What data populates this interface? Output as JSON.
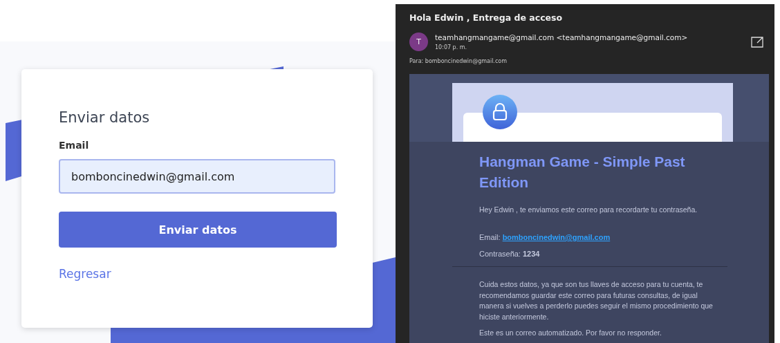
{
  "login": {
    "title": "Enviar datos",
    "email_label": "Email",
    "email_value": "bomboncinedwin@gmail.com",
    "submit_label": "Enviar datos",
    "back_link": "Regresar"
  },
  "email": {
    "subject": "Hola Edwin , Entrega de acceso",
    "sender_initial": "T",
    "sender": "teamhangmangame@gmail.com <teamhangmangame@gmail.com>",
    "time": "10:07 p. m.",
    "to": "Para: bomboncinedwin@gmail.com",
    "message": {
      "title": "Hangman Game - Simple Past Edition",
      "intro": "Hey Edwin , te enviamos este correo para recordarte tu contraseña.",
      "email_label": "Email:",
      "email_value": "bomboncinedwin@gmail.com",
      "password_line": "Contraseña: **1234**",
      "paragraph": "Cuida estos datos, ya que son tus llaves de acceso para tu cuenta, te recomendamos guardar este correo para futuras consultas, de igual manera si vuelves a perderlo puedes seguir el mismo procedimiento que hiciste anteriormente.",
      "footer": "Este es un correo automatizado. Por favor no responder."
    }
  }
}
